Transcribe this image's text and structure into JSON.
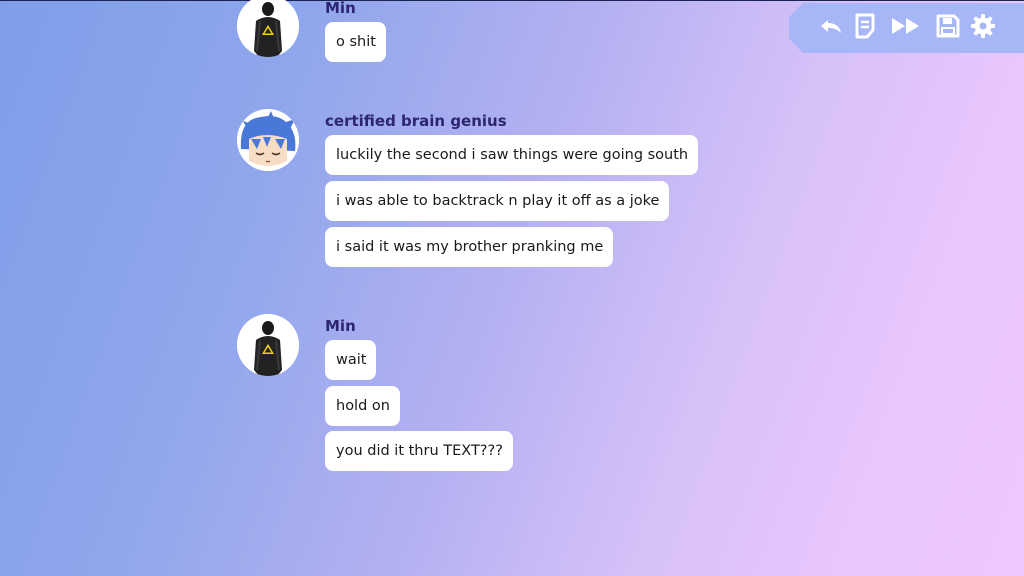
{
  "toolbar": {
    "items": [
      {
        "icon": "undo-icon"
      },
      {
        "icon": "history-icon"
      },
      {
        "icon": "fast-forward-icon"
      },
      {
        "icon": "save-icon"
      },
      {
        "icon": "settings-gear-icon"
      }
    ],
    "icon_color": "#ffffff",
    "background": "#a6b6f6"
  },
  "chat": {
    "groups": [
      {
        "sender": "Min",
        "avatar": "min-avatar",
        "messages": [
          "o shit"
        ]
      },
      {
        "sender": "certified brain genius",
        "avatar": "genius-avatar",
        "messages": [
          "luckily the second i saw things were going south",
          "i was able to backtrack n play it off as a joke",
          "i said it was my brother pranking me"
        ]
      },
      {
        "sender": "Min",
        "avatar": "min-avatar",
        "messages": [
          "wait",
          "hold on",
          "you did it thru TEXT???"
        ]
      }
    ],
    "name_color": "#2e2570"
  }
}
